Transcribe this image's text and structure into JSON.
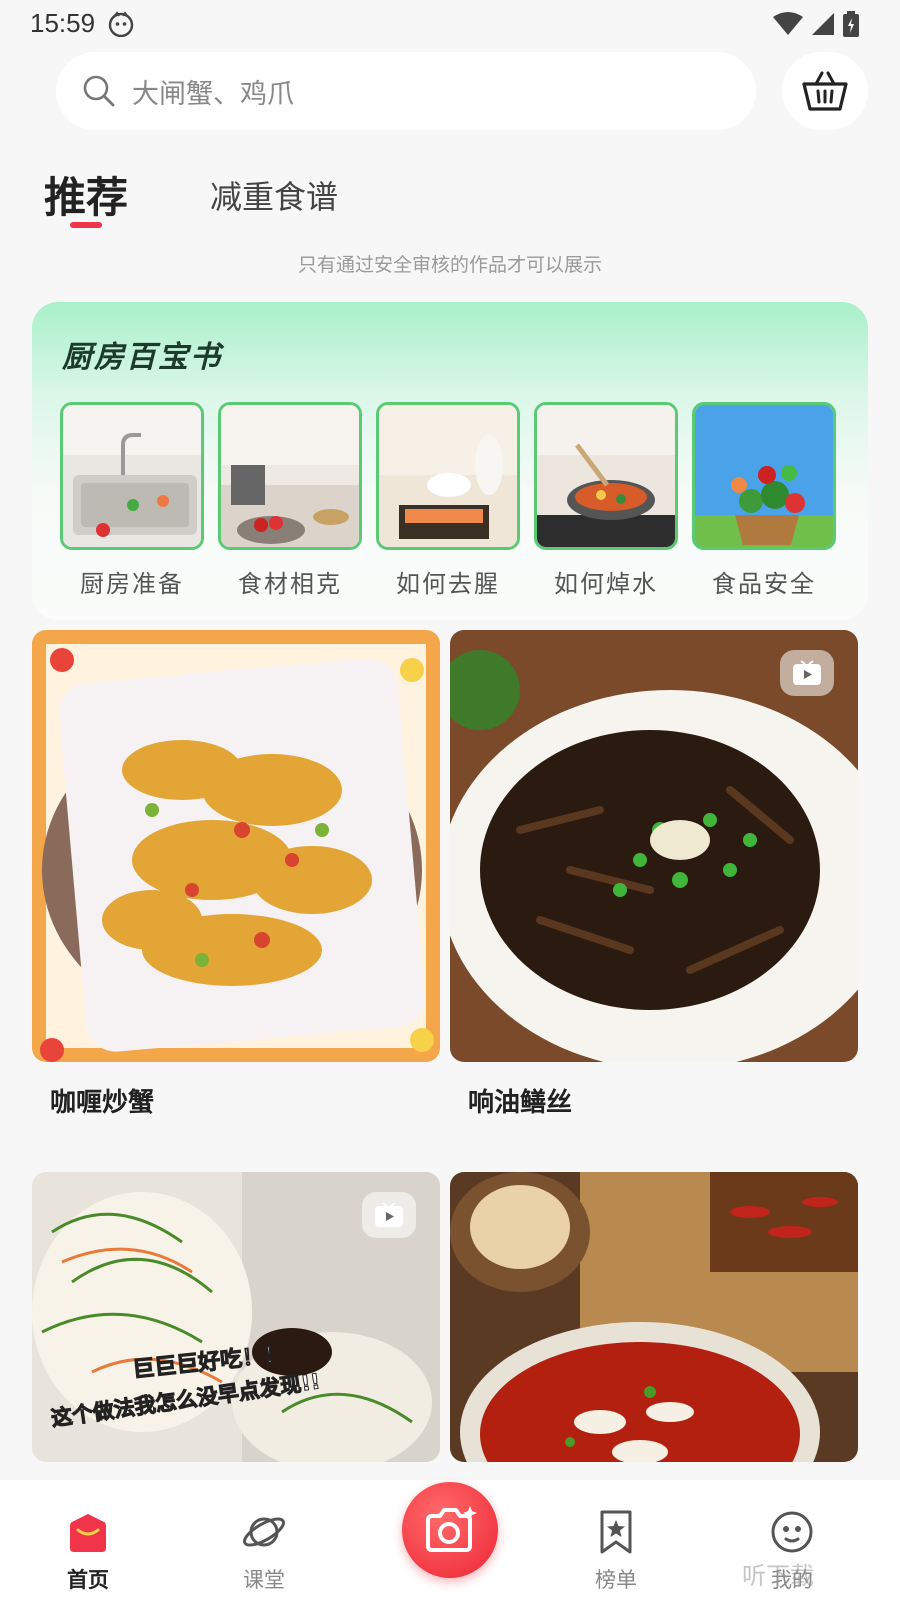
{
  "status_bar": {
    "time": "15:59"
  },
  "search": {
    "placeholder": "大闸蟹、鸡爪"
  },
  "tabs": [
    {
      "label": "推荐",
      "active": true
    },
    {
      "label": "减重食谱",
      "active": false
    }
  ],
  "notice": "只有通过安全审核的作品才可以展示",
  "kitchen": {
    "title": "厨房百宝书",
    "items": [
      {
        "label": "厨房准备",
        "icon": "kitchen-sink-photo"
      },
      {
        "label": "食材相克",
        "icon": "ingredients-photo"
      },
      {
        "label": "如何去腥",
        "icon": "prep-photo"
      },
      {
        "label": "如何焯水",
        "icon": "wok-photo"
      },
      {
        "label": "食品安全",
        "icon": "vegetables-photo"
      }
    ]
  },
  "feed": [
    {
      "title": "咖喱炒蟹",
      "video": false
    },
    {
      "title": "响油鳝丝",
      "video": true
    },
    {
      "title": "",
      "video": true,
      "overlay_line1": "巨巨巨好吃！！",
      "overlay_line2": "这个做法我怎么没早点发现!!"
    },
    {
      "title": "",
      "video": false
    }
  ],
  "nav": {
    "items": [
      {
        "label": "首页",
        "icon": "home-icon",
        "active": true
      },
      {
        "label": "课堂",
        "icon": "planet-icon",
        "active": false
      },
      {
        "label": "榜单",
        "icon": "bookmark-star-icon",
        "active": false
      },
      {
        "label": "我的",
        "icon": "face-icon",
        "active": false
      }
    ]
  },
  "watermark": "听下载",
  "colors": {
    "accent": "#f0344a",
    "green_border": "#5acb74"
  }
}
